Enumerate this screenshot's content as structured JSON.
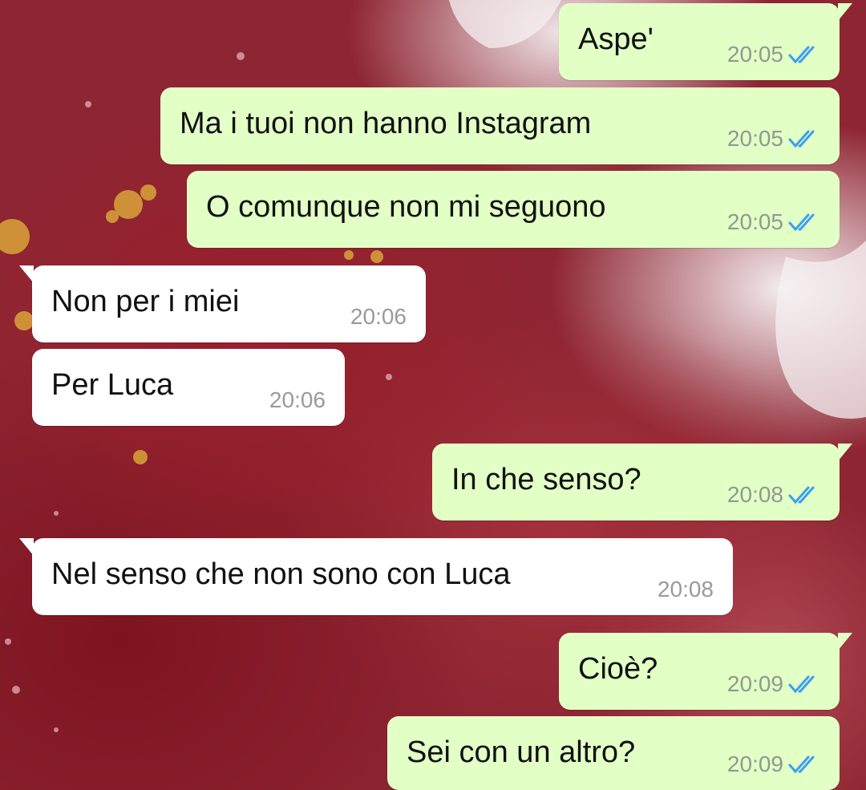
{
  "colors": {
    "outgoing_bubble": "#e2ffc6",
    "incoming_bubble": "#ffffff",
    "read_tick": "#3b9ef3",
    "wallpaper_main": "#8e2532"
  },
  "messages": [
    {
      "direction": "out",
      "text": "Aspe'",
      "time": "20:05",
      "status_icon": "double-check-read-icon"
    },
    {
      "direction": "out",
      "text": "Ma i tuoi non hanno Instagram",
      "time": "20:05",
      "status_icon": "double-check-read-icon"
    },
    {
      "direction": "out",
      "text": "O comunque non mi seguono",
      "time": "20:05",
      "status_icon": "double-check-read-icon"
    },
    {
      "direction": "in",
      "text": "Non per i miei",
      "time": "20:06"
    },
    {
      "direction": "in",
      "text": "Per Luca",
      "time": "20:06"
    },
    {
      "direction": "out",
      "text": "In che senso?",
      "time": "20:08",
      "status_icon": "double-check-read-icon"
    },
    {
      "direction": "in",
      "text": "Nel senso che non sono con Luca",
      "time": "20:08"
    },
    {
      "direction": "out",
      "text": "Cioè?",
      "time": "20:09",
      "status_icon": "double-check-read-icon"
    },
    {
      "direction": "out",
      "text": "Sei con un altro?",
      "time": "20:09",
      "status_icon": "double-check-read-icon"
    }
  ]
}
